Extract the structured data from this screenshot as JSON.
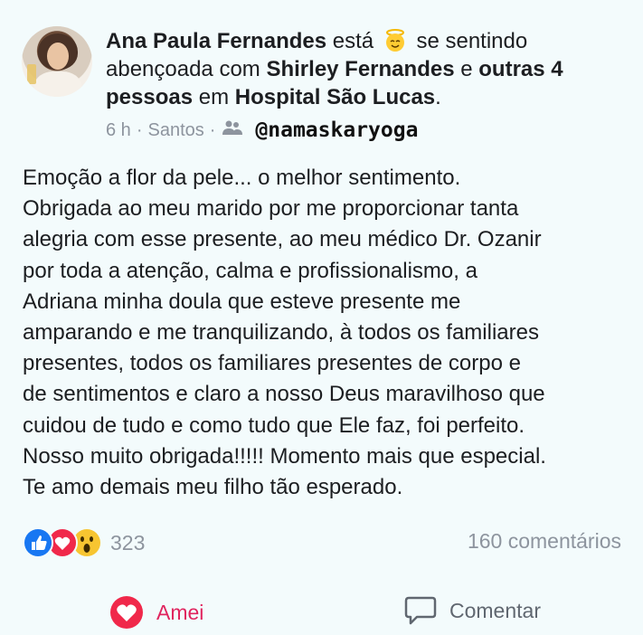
{
  "post": {
    "author": "Ana Paula Fernandes",
    "esta": "está",
    "feeling_emoji": "angel-emoji",
    "feeling_text": "se sentindo abençoada com",
    "tagged": "Shirley Fernandes",
    "and": "e",
    "others": "outras 4 pessoas",
    "at": "em",
    "place": "Hospital São Lucas",
    "period": ".",
    "time": "6 h",
    "separator": "·",
    "location": "Santos",
    "audience_icon": "friends-icon",
    "watermark": "@namaskaryoga",
    "body_lines": [
      "Emoção a flor da pele... o melhor sentimento.",
      "Obrigada ao meu marido por me proporcionar tanta",
      "alegria com esse presente, ao meu médico Dr. Ozanir",
      "por toda a atenção, calma e profissionalismo, a",
      "Adriana minha doula que esteve presente me",
      "amparando e me tranquilizando, à todos os familiares",
      "presentes, todos os familiares presentes de corpo e",
      "de sentimentos e claro a nosso Deus maravilhoso que",
      "cuidou de tudo e como tudo que Ele faz, foi perfeito.",
      "Nosso muito obrigada!!!!! Momento mais que especial.",
      "Te amo demais meu filho tão esperado."
    ]
  },
  "reactions": {
    "icons": [
      "like-icon",
      "love-icon",
      "wow-icon"
    ],
    "count": "323",
    "comments": "160 comentários"
  },
  "actions": {
    "love_label": "Amei",
    "comment_label": "Comentar"
  },
  "colors": {
    "background": "#f3fbfc",
    "love": "#e0245e",
    "like": "#1877f2",
    "muted": "#8d949e"
  }
}
